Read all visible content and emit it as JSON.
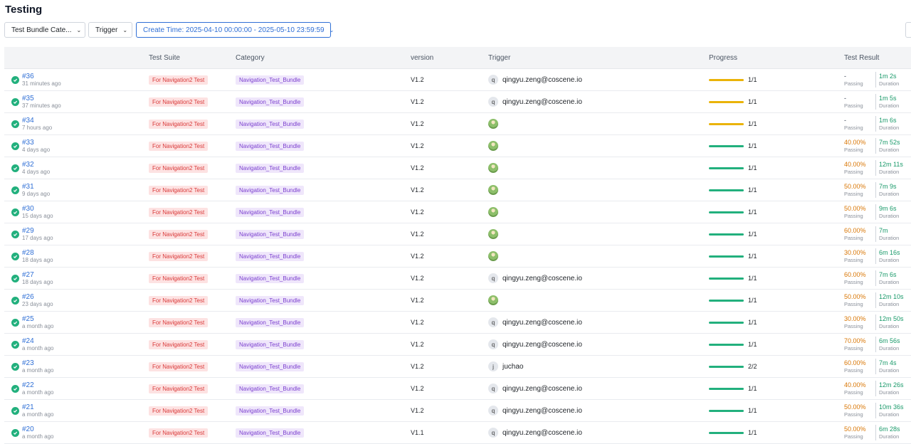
{
  "page": {
    "title": "Testing"
  },
  "filters": {
    "category": "Test Bundle Cate...",
    "trigger": "Trigger",
    "create_time": "Create Time: 2025-04-10 00:00:00 - 2025-05-10 23:59:59"
  },
  "columns": [
    "",
    "Test Suite",
    "Category",
    "version",
    "Trigger",
    "Progress",
    "Test Result"
  ],
  "labels": {
    "passing": "Passing",
    "duration": "Duration"
  },
  "rows": [
    {
      "id": "#36",
      "ago": "31 minutes ago",
      "suite": "For Navigation2 Test",
      "category": "Navigation_Test_Bundle",
      "version": "V1.2",
      "trigger_initial": "q",
      "trigger": "qingyu.zeng@coscene.io",
      "progress": "1/1",
      "bar": "yellow",
      "result": "-",
      "duration": "1m 2s"
    },
    {
      "id": "#35",
      "ago": "37 minutes ago",
      "suite": "For Navigation2 Test",
      "category": "Navigation_Test_Bundle",
      "version": "V1.2",
      "trigger_initial": "q",
      "trigger": "qingyu.zeng@coscene.io",
      "progress": "1/1",
      "bar": "yellow",
      "result": "-",
      "duration": "1m 5s"
    },
    {
      "id": "#34",
      "ago": "7 hours ago",
      "suite": "For Navigation2 Test",
      "category": "Navigation_Test_Bundle",
      "version": "V1.2",
      "trigger_initial": "",
      "trigger": "",
      "progress": "1/1",
      "bar": "yellow",
      "result": "-",
      "duration": "1m 6s"
    },
    {
      "id": "#33",
      "ago": "4 days ago",
      "suite": "For Navigation2 Test",
      "category": "Navigation_Test_Bundle",
      "version": "V1.2",
      "trigger_initial": "",
      "trigger": "",
      "progress": "1/1",
      "bar": "green",
      "result": "40.00%",
      "duration": "7m 52s"
    },
    {
      "id": "#32",
      "ago": "4 days ago",
      "suite": "For Navigation2 Test",
      "category": "Navigation_Test_Bundle",
      "version": "V1.2",
      "trigger_initial": "",
      "trigger": "",
      "progress": "1/1",
      "bar": "green",
      "result": "40.00%",
      "duration": "12m 11s"
    },
    {
      "id": "#31",
      "ago": "9 days ago",
      "suite": "For Navigation2 Test",
      "category": "Navigation_Test_Bundle",
      "version": "V1.2",
      "trigger_initial": "",
      "trigger": "",
      "progress": "1/1",
      "bar": "green",
      "result": "50.00%",
      "duration": "7m 9s"
    },
    {
      "id": "#30",
      "ago": "15 days ago",
      "suite": "For Navigation2 Test",
      "category": "Navigation_Test_Bundle",
      "version": "V1.2",
      "trigger_initial": "",
      "trigger": "",
      "progress": "1/1",
      "bar": "green",
      "result": "50.00%",
      "duration": "9m 6s"
    },
    {
      "id": "#29",
      "ago": "17 days ago",
      "suite": "For Navigation2 Test",
      "category": "Navigation_Test_Bundle",
      "version": "V1.2",
      "trigger_initial": "",
      "trigger": "",
      "progress": "1/1",
      "bar": "green",
      "result": "60.00%",
      "duration": "7m"
    },
    {
      "id": "#28",
      "ago": "18 days ago",
      "suite": "For Navigation2 Test",
      "category": "Navigation_Test_Bundle",
      "version": "V1.2",
      "trigger_initial": "",
      "trigger": "",
      "progress": "1/1",
      "bar": "green",
      "result": "30.00%",
      "duration": "6m 16s"
    },
    {
      "id": "#27",
      "ago": "18 days ago",
      "suite": "For Navigation2 Test",
      "category": "Navigation_Test_Bundle",
      "version": "V1.2",
      "trigger_initial": "q",
      "trigger": "qingyu.zeng@coscene.io",
      "progress": "1/1",
      "bar": "green",
      "result": "60.00%",
      "duration": "7m 6s"
    },
    {
      "id": "#26",
      "ago": "23 days ago",
      "suite": "For Navigation2 Test",
      "category": "Navigation_Test_Bundle",
      "version": "V1.2",
      "trigger_initial": "",
      "trigger": "",
      "progress": "1/1",
      "bar": "green",
      "result": "50.00%",
      "duration": "12m 10s"
    },
    {
      "id": "#25",
      "ago": "a month ago",
      "suite": "For Navigation2 Test",
      "category": "Navigation_Test_Bundle",
      "version": "V1.2",
      "trigger_initial": "q",
      "trigger": "qingyu.zeng@coscene.io",
      "progress": "1/1",
      "bar": "green",
      "result": "30.00%",
      "duration": "12m 50s"
    },
    {
      "id": "#24",
      "ago": "a month ago",
      "suite": "For Navigation2 Test",
      "category": "Navigation_Test_Bundle",
      "version": "V1.2",
      "trigger_initial": "q",
      "trigger": "qingyu.zeng@coscene.io",
      "progress": "1/1",
      "bar": "green",
      "result": "70.00%",
      "duration": "6m 56s"
    },
    {
      "id": "#23",
      "ago": "a month ago",
      "suite": "For Navigation2 Test",
      "category": "Navigation_Test_Bundle",
      "version": "V1.2",
      "trigger_initial": "j",
      "trigger": "juchao",
      "progress": "2/2",
      "bar": "green",
      "result": "60.00%",
      "duration": "7m 4s"
    },
    {
      "id": "#22",
      "ago": "a month ago",
      "suite": "For Navigation2 Test",
      "category": "Navigation_Test_Bundle",
      "version": "V1.2",
      "trigger_initial": "q",
      "trigger": "qingyu.zeng@coscene.io",
      "progress": "1/1",
      "bar": "green",
      "result": "40.00%",
      "duration": "12m 26s"
    },
    {
      "id": "#21",
      "ago": "a month ago",
      "suite": "For Navigation2 Test",
      "category": "Navigation_Test_Bundle",
      "version": "V1.2",
      "trigger_initial": "q",
      "trigger": "qingyu.zeng@coscene.io",
      "progress": "1/1",
      "bar": "green",
      "result": "50.00%",
      "duration": "10m 36s"
    },
    {
      "id": "#20",
      "ago": "a month ago",
      "suite": "For Navigation2 Test",
      "category": "Navigation_Test_Bundle",
      "version": "V1.1",
      "trigger_initial": "q",
      "trigger": "qingyu.zeng@coscene.io",
      "progress": "1/1",
      "bar": "green",
      "result": "50.00%",
      "duration": "6m 28s"
    }
  ]
}
